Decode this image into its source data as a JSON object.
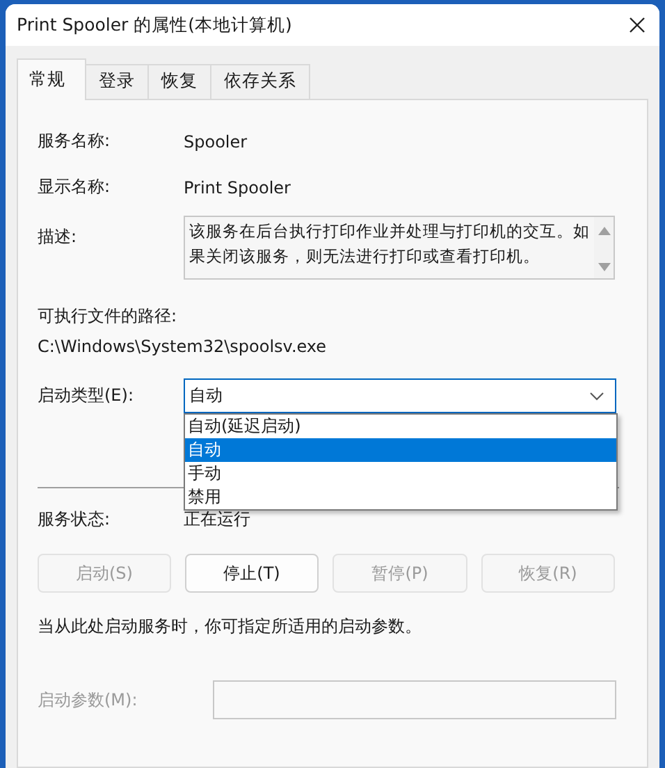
{
  "window": {
    "title": "Print Spooler 的属性(本地计算机)"
  },
  "tabs": [
    {
      "label": "常规",
      "selected": true
    },
    {
      "label": "登录",
      "selected": false
    },
    {
      "label": "恢复",
      "selected": false
    },
    {
      "label": "依存关系",
      "selected": false
    }
  ],
  "service_name": {
    "label": "服务名称:",
    "value": "Spooler"
  },
  "display_name": {
    "label": "显示名称:",
    "value": "Print Spooler"
  },
  "description": {
    "label": "描述:",
    "value": "该服务在后台执行打印作业并处理与打印机的交互。如果关闭该服务，则无法进行打印或查看打印机。"
  },
  "path": {
    "label": "可执行文件的路径:",
    "value": "C:\\Windows\\System32\\spoolsv.exe"
  },
  "startup_type": {
    "label": "启动类型(E):",
    "value": "自动",
    "expanded": true,
    "options": [
      {
        "label": "自动(延迟启动)",
        "selected": false
      },
      {
        "label": "自动",
        "selected": true
      },
      {
        "label": "手动",
        "selected": false
      },
      {
        "label": "禁用",
        "selected": false
      }
    ]
  },
  "service_status": {
    "label": "服务状态:",
    "value": "正在运行"
  },
  "buttons": [
    {
      "label": "启动(S)",
      "disabled": true
    },
    {
      "label": "停止(T)",
      "disabled": false
    },
    {
      "label": "暂停(P)",
      "disabled": true
    },
    {
      "label": "恢复(R)",
      "disabled": true
    }
  ],
  "hint": "当从此处启动服务时，你可指定所适用的启动参数。",
  "start_params": {
    "label": "启动参数(M):",
    "disabled": true
  }
}
